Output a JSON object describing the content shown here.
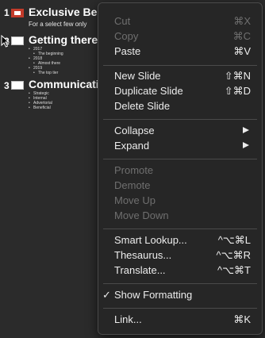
{
  "outline": {
    "slides": [
      {
        "number": "1",
        "title": "Exclusive Benefi",
        "subtitle": "For a select few only",
        "selected": true
      },
      {
        "number": "2",
        "title": "Getting there so",
        "bullets": [
          {
            "text": "2017",
            "level": 1
          },
          {
            "text": "The beginning",
            "level": 2
          },
          {
            "text": "2018",
            "level": 1
          },
          {
            "text": "Almost there",
            "level": 2
          },
          {
            "text": "2019",
            "level": 1
          },
          {
            "text": "The top tier",
            "level": 2
          }
        ]
      },
      {
        "number": "3",
        "title": "Communication",
        "bullets": [
          {
            "text": "Strategic",
            "level": 1
          },
          {
            "text": "Internal",
            "level": 1
          },
          {
            "text": "Advertorial",
            "level": 1
          },
          {
            "text": "Beneficial",
            "level": 1
          }
        ]
      }
    ]
  },
  "context_menu": {
    "items": {
      "cut": {
        "label": "Cut",
        "shortcut": "⌘X",
        "enabled": false
      },
      "copy": {
        "label": "Copy",
        "shortcut": "⌘C",
        "enabled": false
      },
      "paste": {
        "label": "Paste",
        "shortcut": "⌘V",
        "enabled": true
      },
      "new_slide": {
        "label": "New Slide",
        "shortcut": "⇧⌘N",
        "enabled": true
      },
      "duplicate_slide": {
        "label": "Duplicate Slide",
        "shortcut": "⇧⌘D",
        "enabled": true
      },
      "delete_slide": {
        "label": "Delete Slide",
        "enabled": true
      },
      "collapse": {
        "label": "Collapse",
        "submenu": true,
        "enabled": true
      },
      "expand": {
        "label": "Expand",
        "submenu": true,
        "enabled": true
      },
      "promote": {
        "label": "Promote",
        "enabled": false
      },
      "demote": {
        "label": "Demote",
        "enabled": false
      },
      "move_up": {
        "label": "Move Up",
        "enabled": false
      },
      "move_down": {
        "label": "Move Down",
        "enabled": false
      },
      "smart_lookup": {
        "label": "Smart Lookup...",
        "shortcut": "^⌥⌘L",
        "enabled": true
      },
      "thesaurus": {
        "label": "Thesaurus...",
        "shortcut": "^⌥⌘R",
        "enabled": true
      },
      "translate": {
        "label": "Translate...",
        "shortcut": "^⌥⌘T",
        "enabled": true
      },
      "show_formatting": {
        "label": "Show Formatting",
        "checked": true,
        "enabled": true
      },
      "link": {
        "label": "Link...",
        "shortcut": "⌘K",
        "enabled": true
      }
    }
  },
  "colors": {
    "background": "#2b2b2b",
    "menu_background": "#262626",
    "selected_slide_border": "#c33b2a",
    "disabled_text": "#6f6f6f"
  }
}
